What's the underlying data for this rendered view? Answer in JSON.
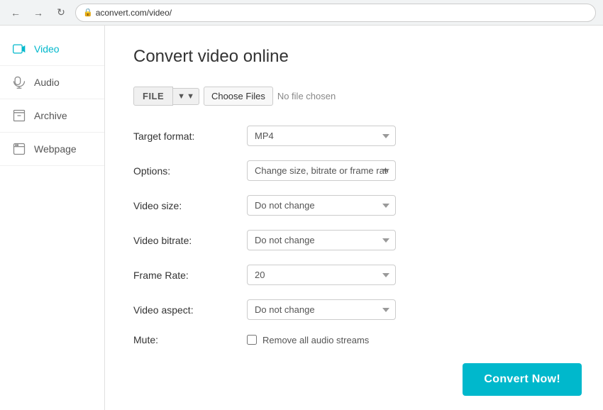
{
  "browser": {
    "url": "aconvert.com/video/"
  },
  "sidebar": {
    "items": [
      {
        "id": "video",
        "label": "Video",
        "icon": "video-icon",
        "active": true
      },
      {
        "id": "audio",
        "label": "Audio",
        "icon": "audio-icon",
        "active": false
      },
      {
        "id": "archive",
        "label": "Archive",
        "icon": "archive-icon",
        "active": false
      },
      {
        "id": "webpage",
        "label": "Webpage",
        "icon": "webpage-icon",
        "active": false
      }
    ]
  },
  "main": {
    "title": "Convert video online",
    "file_section": {
      "file_btn_label": "FILE",
      "choose_files_label": "Choose Files",
      "no_file_text": "No file chosen"
    },
    "form": {
      "target_format_label": "Target format:",
      "target_format_value": "MP4",
      "options_label": "Options:",
      "options_value": "Change size, bitrate or frame rate",
      "video_size_label": "Video size:",
      "video_size_value": "Do not change",
      "video_bitrate_label": "Video bitrate:",
      "video_bitrate_value": "Do not change",
      "frame_rate_label": "Frame Rate:",
      "frame_rate_value": "20",
      "video_aspect_label": "Video aspect:",
      "video_aspect_value": "Do not change",
      "mute_label": "Mute:",
      "mute_checkbox_label": "Remove all audio streams"
    },
    "convert_btn_label": "Convert Now!"
  }
}
